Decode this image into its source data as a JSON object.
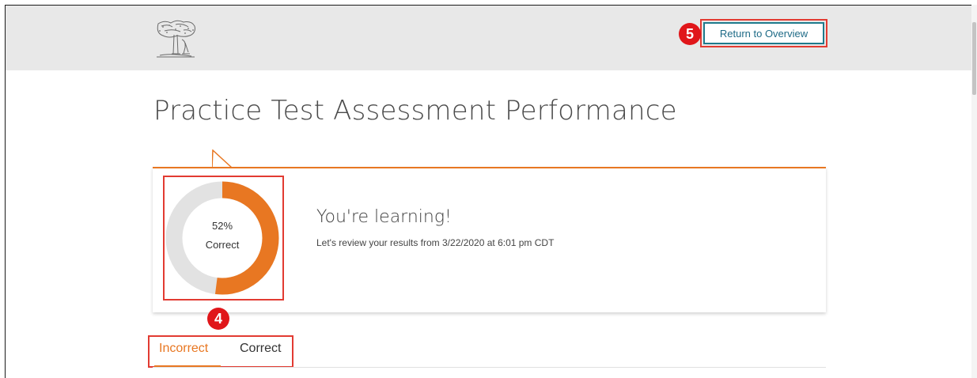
{
  "header": {
    "logo_icon": "tree-scholar-logo-icon",
    "return_button_label": "Return to Overview",
    "step_badge": "5"
  },
  "page": {
    "title": "Practice Test Assessment Performance"
  },
  "result_card": {
    "score_percent": 52,
    "score_text": "52%",
    "score_label": "Correct",
    "heading": "You're learning!",
    "subtext": "Let's review your results from 3/22/2020 at 6:01 pm CDT",
    "step_badge": "4"
  },
  "tabs": [
    {
      "label": "Incorrect",
      "active": true
    },
    {
      "label": "Correct",
      "active": false
    }
  ],
  "colors": {
    "accent": "#e87722",
    "ring_background": "#e2e2e2",
    "button_border": "#1e7a8c",
    "highlight": "#e23b32",
    "badge": "#e0161a"
  }
}
